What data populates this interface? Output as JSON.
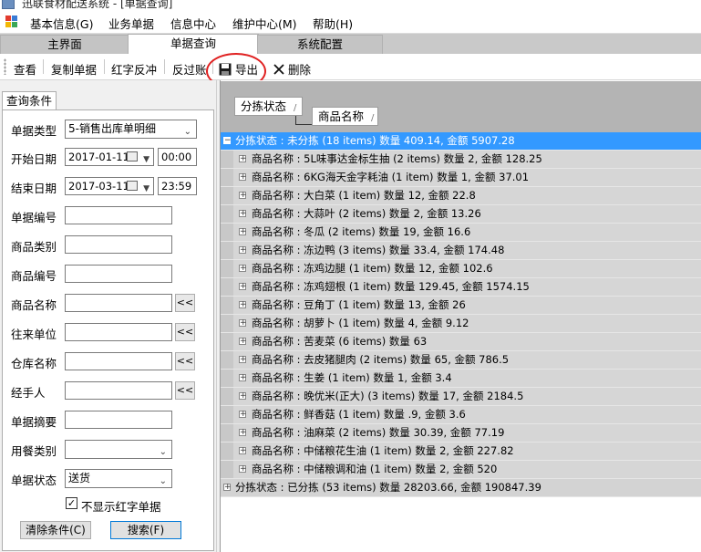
{
  "window": {
    "title": "迅联食材配送系统 - [单据查询]"
  },
  "menu": [
    {
      "label": "基本信息(G)"
    },
    {
      "label": "业务单据"
    },
    {
      "label": "信息中心"
    },
    {
      "label": "维护中心(M)"
    },
    {
      "label": "帮助(H)"
    }
  ],
  "tabs": [
    {
      "label": "主界面",
      "active": false
    },
    {
      "label": "单据查询",
      "active": true
    },
    {
      "label": "系统配置",
      "active": false
    }
  ],
  "toolbar": {
    "view": "查看",
    "copy": "复制单据",
    "red_reverse": "红字反冲",
    "reverse_post": "反过账",
    "export": "导出",
    "delete": "删除"
  },
  "query": {
    "tab_label": "查询条件",
    "fields": {
      "doc_type": {
        "label": "单据类型",
        "value": "5-销售出库单明细"
      },
      "start_date": {
        "label": "开始日期",
        "date": "2017-01-11",
        "time": "00:00"
      },
      "end_date": {
        "label": "结束日期",
        "date": "2017-03-11",
        "time": "23:59"
      },
      "doc_no": {
        "label": "单据编号",
        "value": ""
      },
      "category": {
        "label": "商品类别",
        "value": ""
      },
      "product_no": {
        "label": "商品编号",
        "value": ""
      },
      "product_name": {
        "label": "商品名称",
        "value": ""
      },
      "partner": {
        "label": "往来单位",
        "value": ""
      },
      "warehouse": {
        "label": "仓库名称",
        "value": ""
      },
      "handler": {
        "label": "经手人",
        "value": ""
      },
      "summary": {
        "label": "单据摘要",
        "value": ""
      },
      "meal_type": {
        "label": "用餐类别",
        "value": ""
      },
      "doc_status": {
        "label": "单据状态",
        "value": "送货"
      }
    },
    "browse_symbol": "<<",
    "hide_red": {
      "label": "不显示红字单据",
      "checked": true,
      "mark": "✓"
    },
    "clear_button": "清除条件(C)",
    "search_button": "搜索(F)"
  },
  "grid": {
    "group_columns": [
      {
        "label": "分拣状态",
        "sort": "/"
      },
      {
        "label": "商品名称",
        "sort": "/"
      }
    ],
    "groups": [
      {
        "text": "分拣状态 : 未分拣 (18 items) 数量 409.14, 金额 5907.28",
        "expanded": true,
        "children": [
          "商品名称 : 5L味事达金标生抽 (2 items) 数量 2, 金额 128.25",
          "商品名称 : 6KG海天金字耗油 (1 item) 数量 1, 金额 37.01",
          "商品名称 : 大白菜 (1 item) 数量 12, 金额 22.8",
          "商品名称 : 大蒜叶 (2 items) 数量 2, 金额 13.26",
          "商品名称 : 冬瓜 (2 items) 数量 19, 金额 16.6",
          "商品名称 : 冻边鸭 (3 items) 数量 33.4, 金额 174.48",
          "商品名称 : 冻鸡边腿 (1 item) 数量 12, 金额 102.6",
          "商品名称 : 冻鸡翅根 (1 item) 数量 129.45, 金额 1574.15",
          "商品名称 : 豆角丁 (1 item) 数量 13, 金额 26",
          "商品名称 : 胡萝卜 (1 item) 数量 4, 金额 9.12",
          "商品名称 : 苦麦菜 (6 items) 数量 63",
          "商品名称 : 去皮猪腿肉 (2 items) 数量 65, 金额 786.5",
          "商品名称 : 生姜 (1 item) 数量 1, 金额 3.4",
          "商品名称 : 晚优米(正大) (3 items) 数量 17, 金额 2184.5",
          "商品名称 : 鲜香菇 (1 item) 数量 .9, 金额 3.6",
          "商品名称 : 油麻菜 (2 items) 数量 30.39, 金额 77.19",
          "商品名称 : 中储粮花生油 (1 item) 数量 2, 金额 227.82",
          "商品名称 : 中储粮调和油 (1 item) 数量 2, 金额 520"
        ]
      },
      {
        "text": "分拣状态 : 已分拣 (53 items) 数量 28203.66, 金额 190847.39",
        "expanded": false,
        "children": []
      }
    ]
  },
  "icons": {
    "save": "floppy-disk-icon",
    "delete": "x-icon",
    "expand": "+",
    "collapse": "−"
  },
  "colors": {
    "selection": "#3399ff",
    "highlight_circle": "#e02020"
  }
}
